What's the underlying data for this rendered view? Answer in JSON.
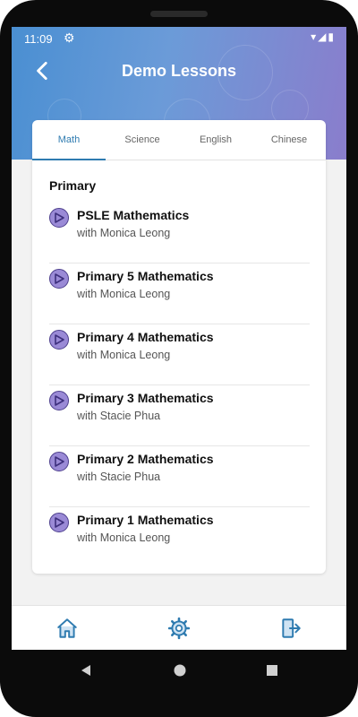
{
  "status": {
    "time": "11:09"
  },
  "header": {
    "title": "Demo Lessons"
  },
  "tabs": [
    {
      "label": "Math"
    },
    {
      "label": "Science"
    },
    {
      "label": "English"
    },
    {
      "label": "Chinese"
    }
  ],
  "section": {
    "title": "Primary"
  },
  "lessons": [
    {
      "title": "PSLE Mathematics",
      "teacher": "with Monica Leong"
    },
    {
      "title": "Primary 5 Mathematics",
      "teacher": "with Monica Leong"
    },
    {
      "title": "Primary 4 Mathematics",
      "teacher": "with Monica Leong"
    },
    {
      "title": "Primary 3 Mathematics",
      "teacher": "with Stacie Phua"
    },
    {
      "title": "Primary 2 Mathematics",
      "teacher": "with Stacie Phua"
    },
    {
      "title": "Primary 1 Mathematics",
      "teacher": "with Monica Leong"
    }
  ],
  "colors": {
    "accent": "#2e7bb0",
    "play_fill": "#9a8ad6",
    "play_border": "#4d3f8d"
  },
  "icons": {
    "back": "chevron-left-icon",
    "home": "home-icon",
    "settings": "gear-icon",
    "logout": "logout-icon",
    "play": "play-icon"
  }
}
